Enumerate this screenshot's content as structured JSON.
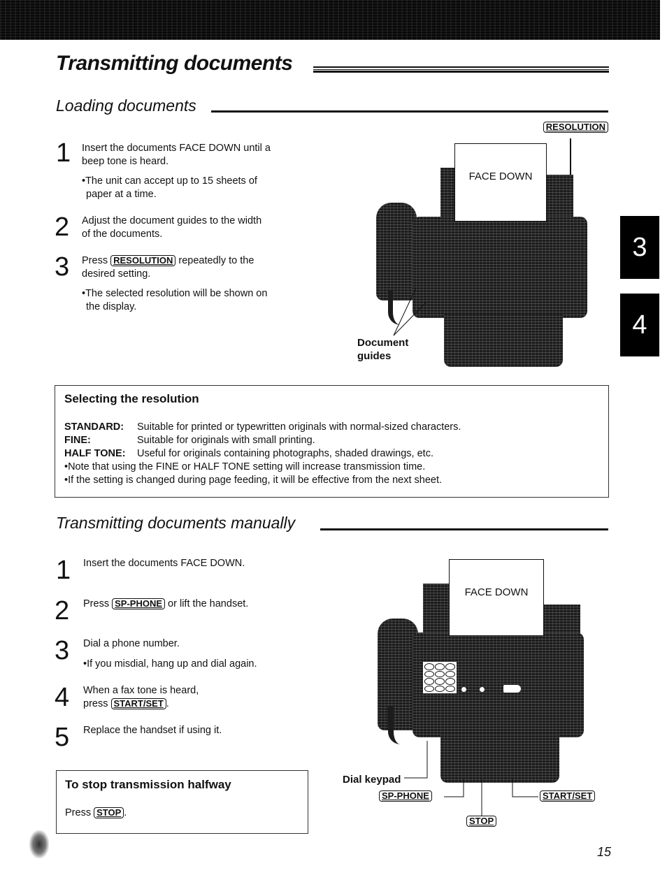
{
  "page": {
    "title": "Transmitting documents",
    "page_number": "15",
    "side_tabs": [
      "3",
      "4"
    ]
  },
  "loading": {
    "heading": "Loading documents",
    "diagram": {
      "resolution_key": "RESOLUTION",
      "paper_label": "FACE DOWN",
      "guides_label_line1": "Document",
      "guides_label_line2": "guides"
    },
    "steps": [
      {
        "num": "1",
        "text_line1": "Insert the documents FACE DOWN until a",
        "text_line2": "beep tone is heard.",
        "note_line1": "•The unit can accept up to 15 sheets of",
        "note_line2": "paper at a time."
      },
      {
        "num": "2",
        "text_line1": "Adjust the document guides to the width",
        "text_line2": "of the documents."
      },
      {
        "num": "3",
        "text_prefix": "Press",
        "key": "RESOLUTION",
        "text_suffix": "repeatedly to the",
        "text_line2": "desired setting.",
        "note_line1": "•The selected resolution will be shown on",
        "note_line2": "the display."
      }
    ]
  },
  "resolution_box": {
    "title": "Selecting the resolution",
    "rows": [
      {
        "term": "STANDARD:",
        "desc": "Suitable for printed or typewritten originals with normal-sized characters."
      },
      {
        "term": "FINE:",
        "desc": "Suitable for originals with small printing."
      },
      {
        "term": "HALF TONE:",
        "desc": "Useful for originals containing photographs, shaded drawings, etc."
      }
    ],
    "notes": [
      "•Note that using the FINE or HALF TONE setting will increase transmission time.",
      "•If the setting is changed during page feeding, it will be effective from the next sheet."
    ]
  },
  "manual": {
    "heading": "Transmitting documents manually",
    "steps": [
      {
        "num": "1",
        "text": "Insert the documents FACE DOWN."
      },
      {
        "num": "2",
        "text_prefix": "Press",
        "key": "SP-PHONE",
        "text_suffix": "or lift the handset."
      },
      {
        "num": "3",
        "text": "Dial a phone number.",
        "note": "•If you misdial, hang up and dial again."
      },
      {
        "num": "4",
        "text_line1": "When a fax tone is heard,",
        "text_prefix": "press",
        "key": "START/SET",
        "text_suffix": "."
      },
      {
        "num": "5",
        "text": "Replace the handset if using it."
      }
    ],
    "stop_box": {
      "title": "To stop transmission halfway",
      "text_prefix": "Press",
      "key": "STOP",
      "text_suffix": "."
    },
    "diagram": {
      "paper_label": "FACE DOWN",
      "dial_keypad_label": "Dial keypad",
      "sp_phone_key": "SP-PHONE",
      "stop_key": "STOP",
      "start_set_key": "START/SET"
    }
  }
}
